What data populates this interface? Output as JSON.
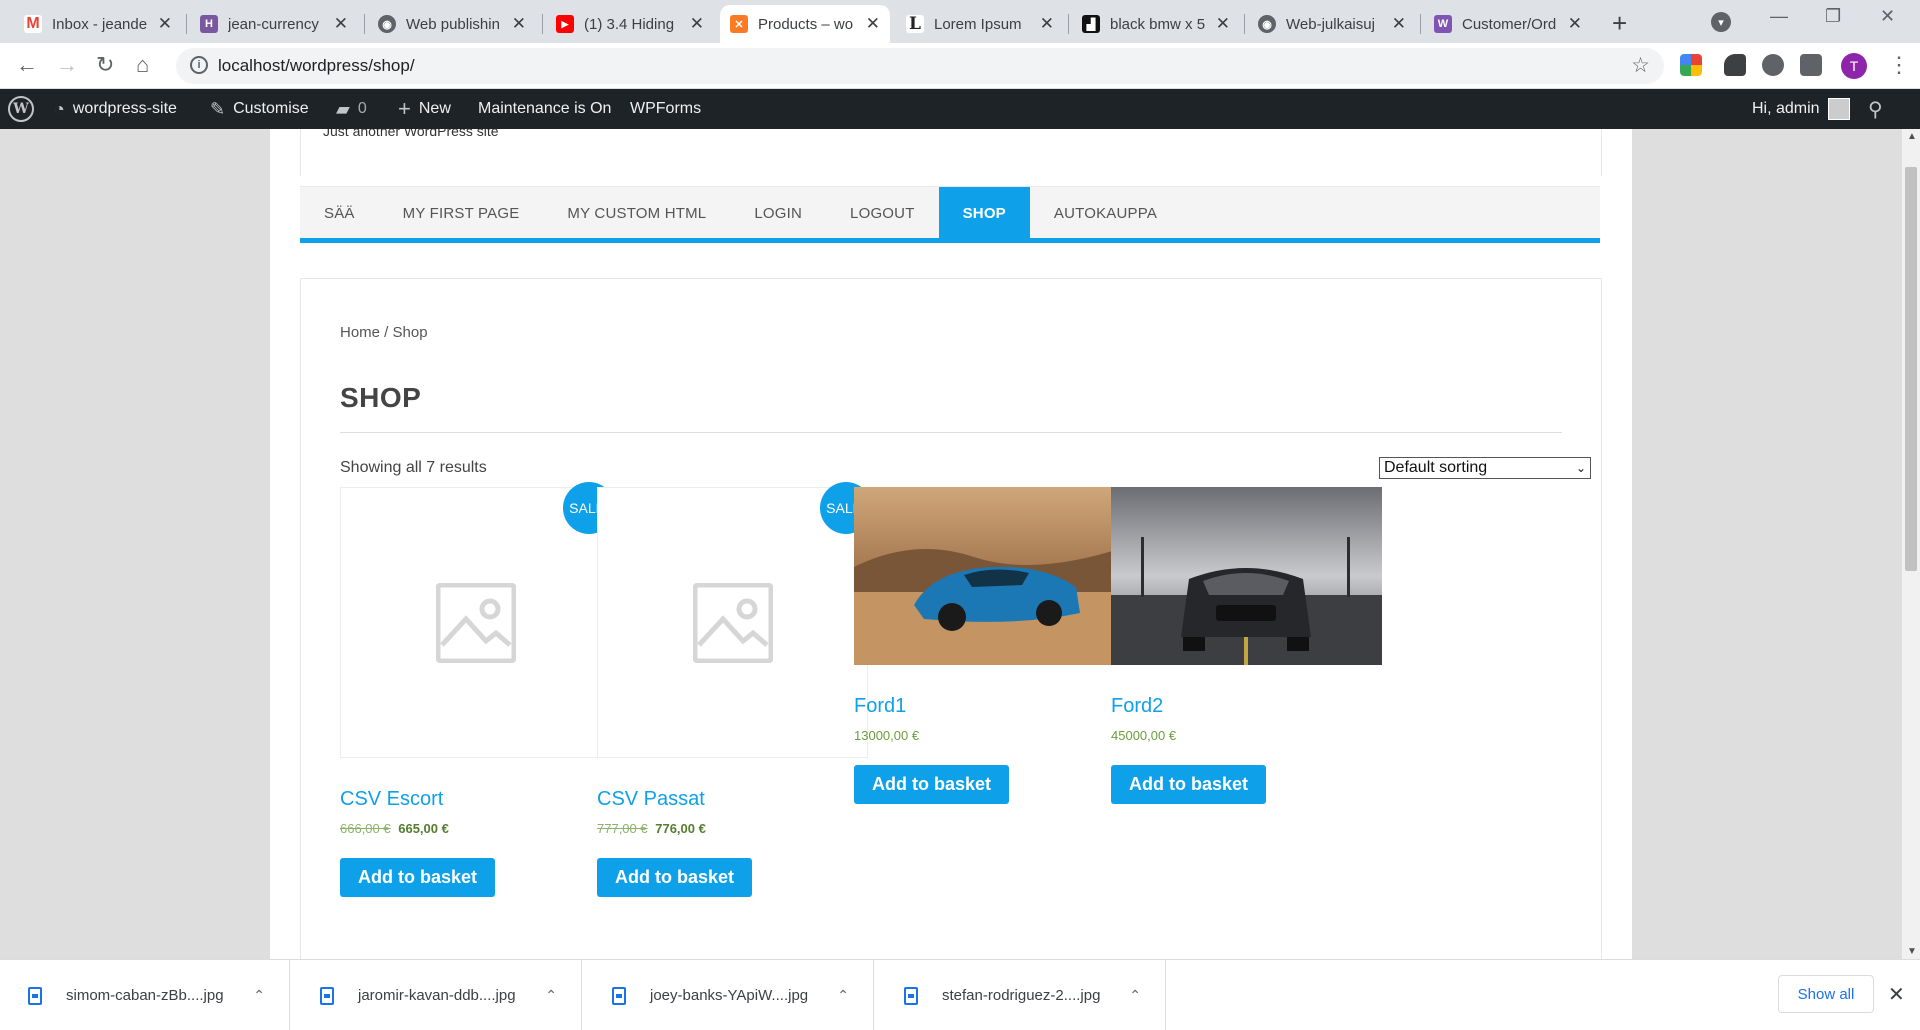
{
  "browser": {
    "tabs": [
      {
        "title": "Inbox - jeande",
        "icon": "gmail-icon",
        "color": "#ea4335",
        "glyph": "M"
      },
      {
        "title": "jean-currency",
        "icon": "heroku-icon",
        "color": "#79589f",
        "glyph": "H"
      },
      {
        "title": "Web publishin",
        "icon": "globe-icon",
        "color": "#5f6368",
        "glyph": "◉"
      },
      {
        "title": "(1) 3.4 Hiding",
        "icon": "youtube-icon",
        "color": "#ff0000",
        "glyph": "▶"
      },
      {
        "title": "Products – wo",
        "icon": "xampp-icon",
        "color": "#fb7a24",
        "glyph": "✕"
      },
      {
        "title": "Lorem Ipsum",
        "icon": "lorem-icon",
        "color": "#222222",
        "glyph": "L"
      },
      {
        "title": "black bmw x 5",
        "icon": "unsplash-icon",
        "color": "#111111",
        "glyph": "▟"
      },
      {
        "title": "Web-julkaisuj",
        "icon": "globe-icon",
        "color": "#5f6368",
        "glyph": "◉"
      },
      {
        "title": "Customer/Ord",
        "icon": "woocommerce-icon",
        "color": "#7f54b3",
        "glyph": "W"
      }
    ],
    "new_tab": "+",
    "url": "localhost/wordpress/shop/",
    "profile_initial": "T"
  },
  "adminbar": {
    "site_name": "wordpress-site",
    "customise": "Customise",
    "comments_count": "0",
    "new_label": "New",
    "maintenance": "Maintenance is On",
    "wpforms": "WPForms",
    "greeting": "Hi, admin"
  },
  "site": {
    "tagline": "Just another WordPress site",
    "nav": [
      "SÄÄ",
      "MY FIRST PAGE",
      "MY CUSTOM HTML",
      "LOGIN",
      "LOGOUT",
      "SHOP",
      "AUTOKAUPPA"
    ],
    "active_nav": "SHOP"
  },
  "shop": {
    "breadcrumb_home": "Home",
    "breadcrumb_sep": " / ",
    "breadcrumb_current": "Shop",
    "title": "SHOP",
    "result_count": "Showing all 7 results",
    "sorting": "Default sorting",
    "products": [
      {
        "name": "CSV Escort",
        "sale_badge": "SALE!",
        "old_price": "666,00 €",
        "price": "665,00 €",
        "button": "Add to basket",
        "image": "placeholder"
      },
      {
        "name": "CSV Passat",
        "sale_badge": "SALE!",
        "old_price": "777,00 €",
        "price": "776,00 €",
        "button": "Add to basket",
        "image": "placeholder"
      },
      {
        "name": "Ford1",
        "price": "13000,00 €",
        "button": "Add to basket",
        "image": "blue-sports-car-photo"
      },
      {
        "name": "Ford2",
        "price": "45000,00 €",
        "button": "Add to basket",
        "image": "black-mustang-photo"
      }
    ]
  },
  "downloads": {
    "files": [
      "simom-caban-zBb....jpg",
      "jaromir-kavan-ddb....jpg",
      "joey-banks-YApiW....jpg",
      "stefan-rodriguez-2....jpg"
    ],
    "show_all": "Show all"
  }
}
